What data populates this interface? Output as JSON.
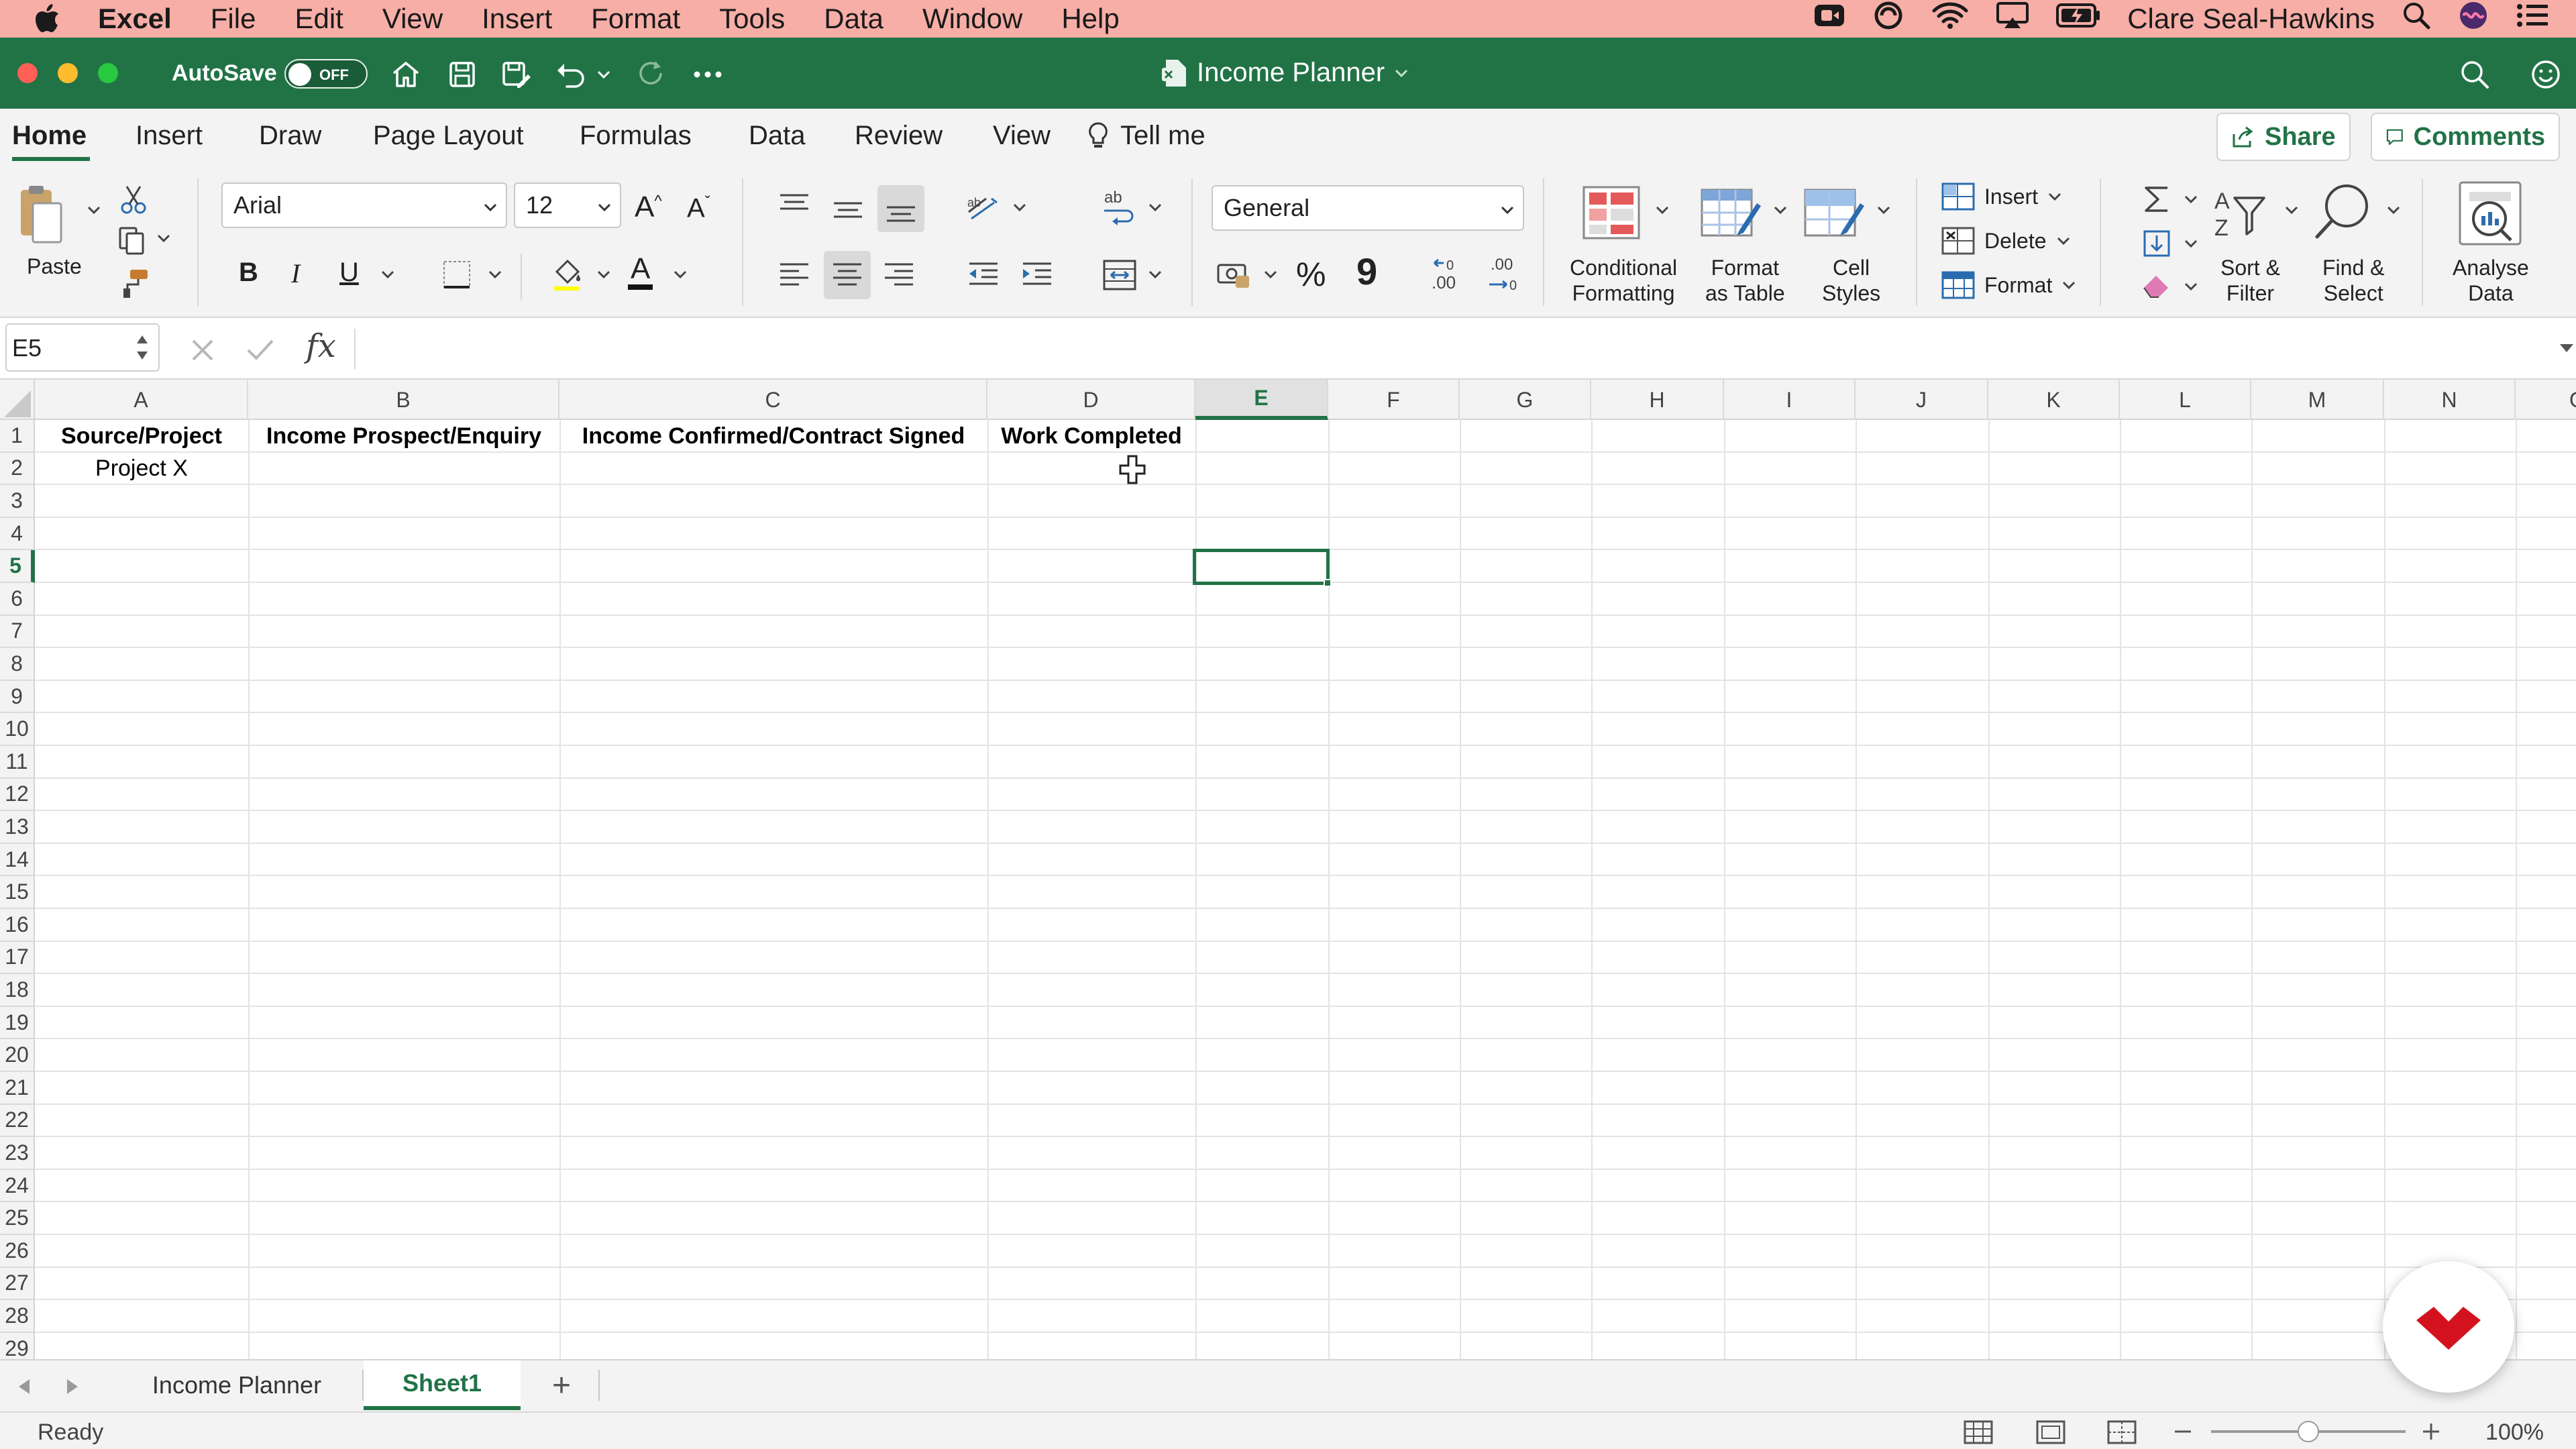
{
  "menubar": {
    "app": "Excel",
    "items": [
      "File",
      "Edit",
      "View",
      "Insert",
      "Format",
      "Tools",
      "Data",
      "Window",
      "Help"
    ],
    "user": "Clare Seal-Hawkins"
  },
  "titlebar": {
    "autosave_label": "AutoSave",
    "autosave_state": "OFF",
    "document_title": "Income Planner"
  },
  "ribbon_tabs": [
    "Home",
    "Insert",
    "Draw",
    "Page Layout",
    "Formulas",
    "Data",
    "Review",
    "View"
  ],
  "tell_me": "Tell me",
  "share_label": "Share",
  "comments_label": "Comments",
  "ribbon": {
    "paste_label": "Paste",
    "font_name": "Arial",
    "font_size": "12",
    "font_grow": "A",
    "font_shrink": "A",
    "bold": "B",
    "italic": "I",
    "underline": "U",
    "font_color_letter": "A",
    "number_format": "General",
    "percent": "%",
    "comma": "9",
    "conditional_formatting": [
      "Conditional",
      "Formatting"
    ],
    "format_as_table": [
      "Format",
      "as Table"
    ],
    "cell_styles": [
      "Cell",
      "Styles"
    ],
    "insert_label": "Insert",
    "delete_label": "Delete",
    "format_label": "Format",
    "sort_filter": [
      "Sort &",
      "Filter"
    ],
    "find_select": [
      "Find &",
      "Select"
    ],
    "analyse_data": [
      "Analyse",
      "Data"
    ]
  },
  "formula_bar": {
    "name_box": "E5",
    "fx": "fx",
    "content": ""
  },
  "columns": [
    "A",
    "B",
    "C",
    "D",
    "E",
    "F",
    "G",
    "H",
    "I",
    "J",
    "K",
    "L",
    "M",
    "N",
    "O"
  ],
  "selected_column": "E",
  "rows": [
    "1",
    "2",
    "3",
    "4",
    "5",
    "6",
    "7",
    "8",
    "9",
    "10",
    "11",
    "12",
    "13",
    "14",
    "15",
    "16",
    "17",
    "18",
    "19",
    "20",
    "21",
    "22",
    "23",
    "24",
    "25",
    "26",
    "27",
    "28",
    "29"
  ],
  "selected_row": "5",
  "cells": {
    "A1": "Source/Project",
    "B1": "Income Prospect/Enquiry",
    "C1": "Income Confirmed/Contract Signed",
    "D1": "Work Completed",
    "A2": "Project X"
  },
  "sheet_tabs": [
    "Income Planner",
    "Sheet1"
  ],
  "active_sheet": "Sheet1",
  "add_sheet": "+",
  "status": {
    "ready": "Ready",
    "zoom": "100%",
    "zoom_fraction": 0.5
  },
  "colors": {
    "excel_green": "#217346",
    "menubar_bg": "#f6aea6",
    "badge_red": "#d4121e"
  },
  "icons": {
    "badge": "red-heart-logo-icon"
  }
}
